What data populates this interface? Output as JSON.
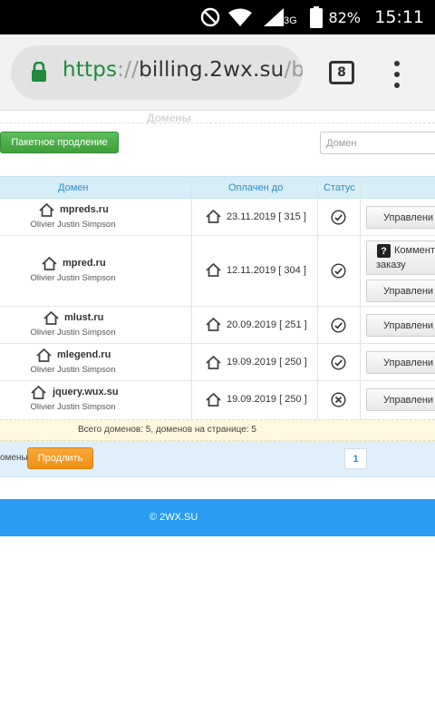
{
  "status_bar": {
    "network_label": "3G",
    "battery_percent": "82%",
    "time": "15:11",
    "icons": [
      "do-not-disturb-icon",
      "wifi-icon",
      "signal-icon",
      "battery-icon"
    ]
  },
  "browser": {
    "url_scheme": "https",
    "url_separator": "://",
    "url_host": "billing.2wx.su",
    "url_path": "/bil",
    "tab_count": "8"
  },
  "page": {
    "section_title": "Домены",
    "batch_button": "Пакетное продление",
    "search_placeholder": "Домен",
    "columns": {
      "domain": "Домен",
      "paid_until": "Оплачен до",
      "status": "Статус"
    },
    "rows": [
      {
        "domain": "mpreds.ru",
        "owner": "Olivier Justin Simpson",
        "paid_until": "23.11.2019 [ 315 ]",
        "status": "ok",
        "manage": "Управлени"
      },
      {
        "domain": "mpred.ru",
        "owner": "Olivier Justin Simpson",
        "paid_until": "12.11.2019 [ 304 ]",
        "status": "ok",
        "comment_line1": "Коммент",
        "comment_line2": "заказу",
        "manage": "Управлени"
      },
      {
        "domain": "mlust.ru",
        "owner": "Olivier Justin Simpson",
        "paid_until": "20.09.2019 [ 251 ]",
        "status": "ok",
        "manage": "Управлени"
      },
      {
        "domain": "mlegend.ru",
        "owner": "Olivier Justin Simpson",
        "paid_until": "19.09.2019 [ 250 ]",
        "status": "ok",
        "manage": "Управлени"
      },
      {
        "domain": "jquery.wux.su",
        "owner": "Olivier Justin Simpson",
        "paid_until": "19.09.2019 [ 250 ]",
        "status": "error",
        "manage": "Управлени"
      }
    ],
    "total_text": "Всего доменов: 5, доменов на странице: 5",
    "domains_label": "омены:",
    "renew_button": "Продлить",
    "page_number": "1",
    "footer": "© 2WX.SU"
  },
  "colors": {
    "url_scheme": "#1f8a3c",
    "batch_button": "#4cae4a",
    "renew_button": "#f39c1f",
    "footer": "#2a9cf1",
    "table_header": "#d7edf8"
  }
}
